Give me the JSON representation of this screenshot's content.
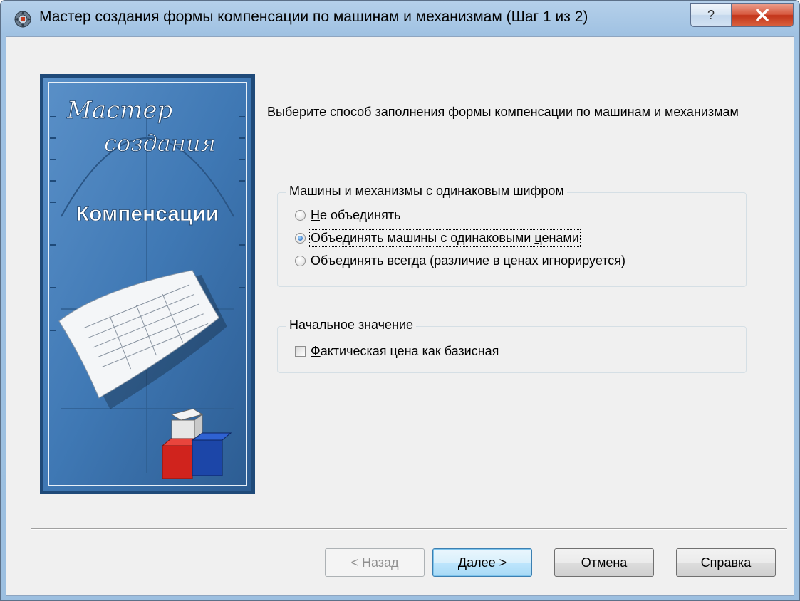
{
  "window": {
    "title": "Мастер создания формы компенсации по машинам и механизмам (Шаг 1 из 2)",
    "icon": "wizard-gear-icon"
  },
  "titlebar_buttons": {
    "help": "?",
    "close": "X"
  },
  "banner": {
    "title_line1": "Мастер",
    "title_line2": "создания",
    "subtitle": "Компенсации"
  },
  "content": {
    "description": "Выберите способ заполнения формы компенсации по машинам и механизмам"
  },
  "group_same_code": {
    "legend": "Машины и механизмы с одинаковым шифром",
    "options": [
      {
        "hotkey": "Н",
        "label": "е объединять",
        "checked": false
      },
      {
        "hotkey": "",
        "label": "Объединять машины с одинаковыми ",
        "hotkey_mid": "ц",
        "label_tail": "енами",
        "checked": true
      },
      {
        "hotkey": "О",
        "label": "бъединять всегда (различие в ценах игнорируется)",
        "checked": false
      }
    ]
  },
  "group_initial": {
    "legend": "Начальное значение",
    "checkbox": {
      "hotkey": "Ф",
      "label": "актическая цена как базисная",
      "checked": false
    }
  },
  "buttons": {
    "back": {
      "prefix": "< ",
      "hotkey": "Н",
      "rest": "азад"
    },
    "next": {
      "hotkey": "Д",
      "rest": "алее >"
    },
    "cancel": "Отмена",
    "help": "Справка"
  }
}
